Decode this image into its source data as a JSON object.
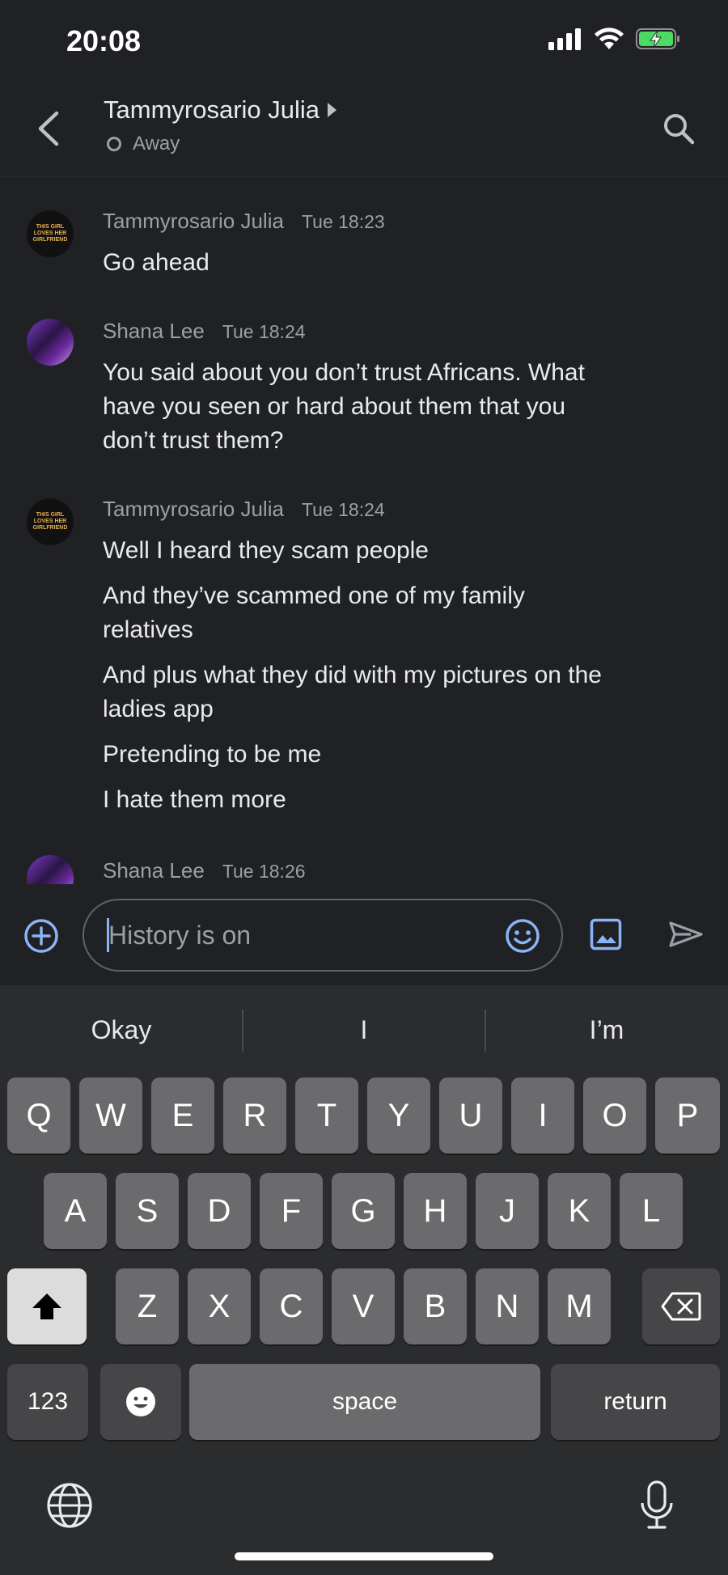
{
  "status_bar": {
    "time": "20:08"
  },
  "header": {
    "title": "Tammyrosario Julia",
    "presence": "Away"
  },
  "avatars": {
    "tammy": "THIS GIRL LOVES HER GIRLFRIEND"
  },
  "messages": [
    {
      "sender": "Tammyrosario Julia",
      "time": "Tue 18:23",
      "lines": [
        "Go ahead"
      ]
    },
    {
      "sender": "Shana Lee",
      "time": "Tue 18:24",
      "lines": [
        "You said about you don’t trust Africans. What",
        "have you seen or hard about them that you",
        "don’t trust them?"
      ]
    },
    {
      "sender": "Tammyrosario Julia",
      "time": "Tue 18:24",
      "lines": [
        "Well I heard they scam people",
        "And they’ve scammed one of my family",
        "relatives",
        "And plus what they did with my  pictures on the",
        "ladies app",
        "Pretending to be me",
        "I hate them more"
      ]
    },
    {
      "sender": "Shana Lee",
      "time": "Tue 18:26"
    }
  ],
  "composer": {
    "placeholder": "History is on"
  },
  "keyboard": {
    "suggestions": [
      "Okay",
      "I",
      "I’m"
    ],
    "row1": [
      "Q",
      "W",
      "E",
      "R",
      "T",
      "Y",
      "U",
      "I",
      "O",
      "P"
    ],
    "row2": [
      "A",
      "S",
      "D",
      "F",
      "G",
      "H",
      "J",
      "K",
      "L"
    ],
    "row3": [
      "Z",
      "X",
      "C",
      "V",
      "B",
      "N",
      "M"
    ],
    "numbers_label": "123",
    "space_label": "space",
    "return_label": "return"
  },
  "colors": {
    "background": "#202124",
    "accent": "#8ab4f8",
    "keyboard": "#2b2c2e",
    "key": "#6b6b6e",
    "battery": "#4cd964"
  }
}
